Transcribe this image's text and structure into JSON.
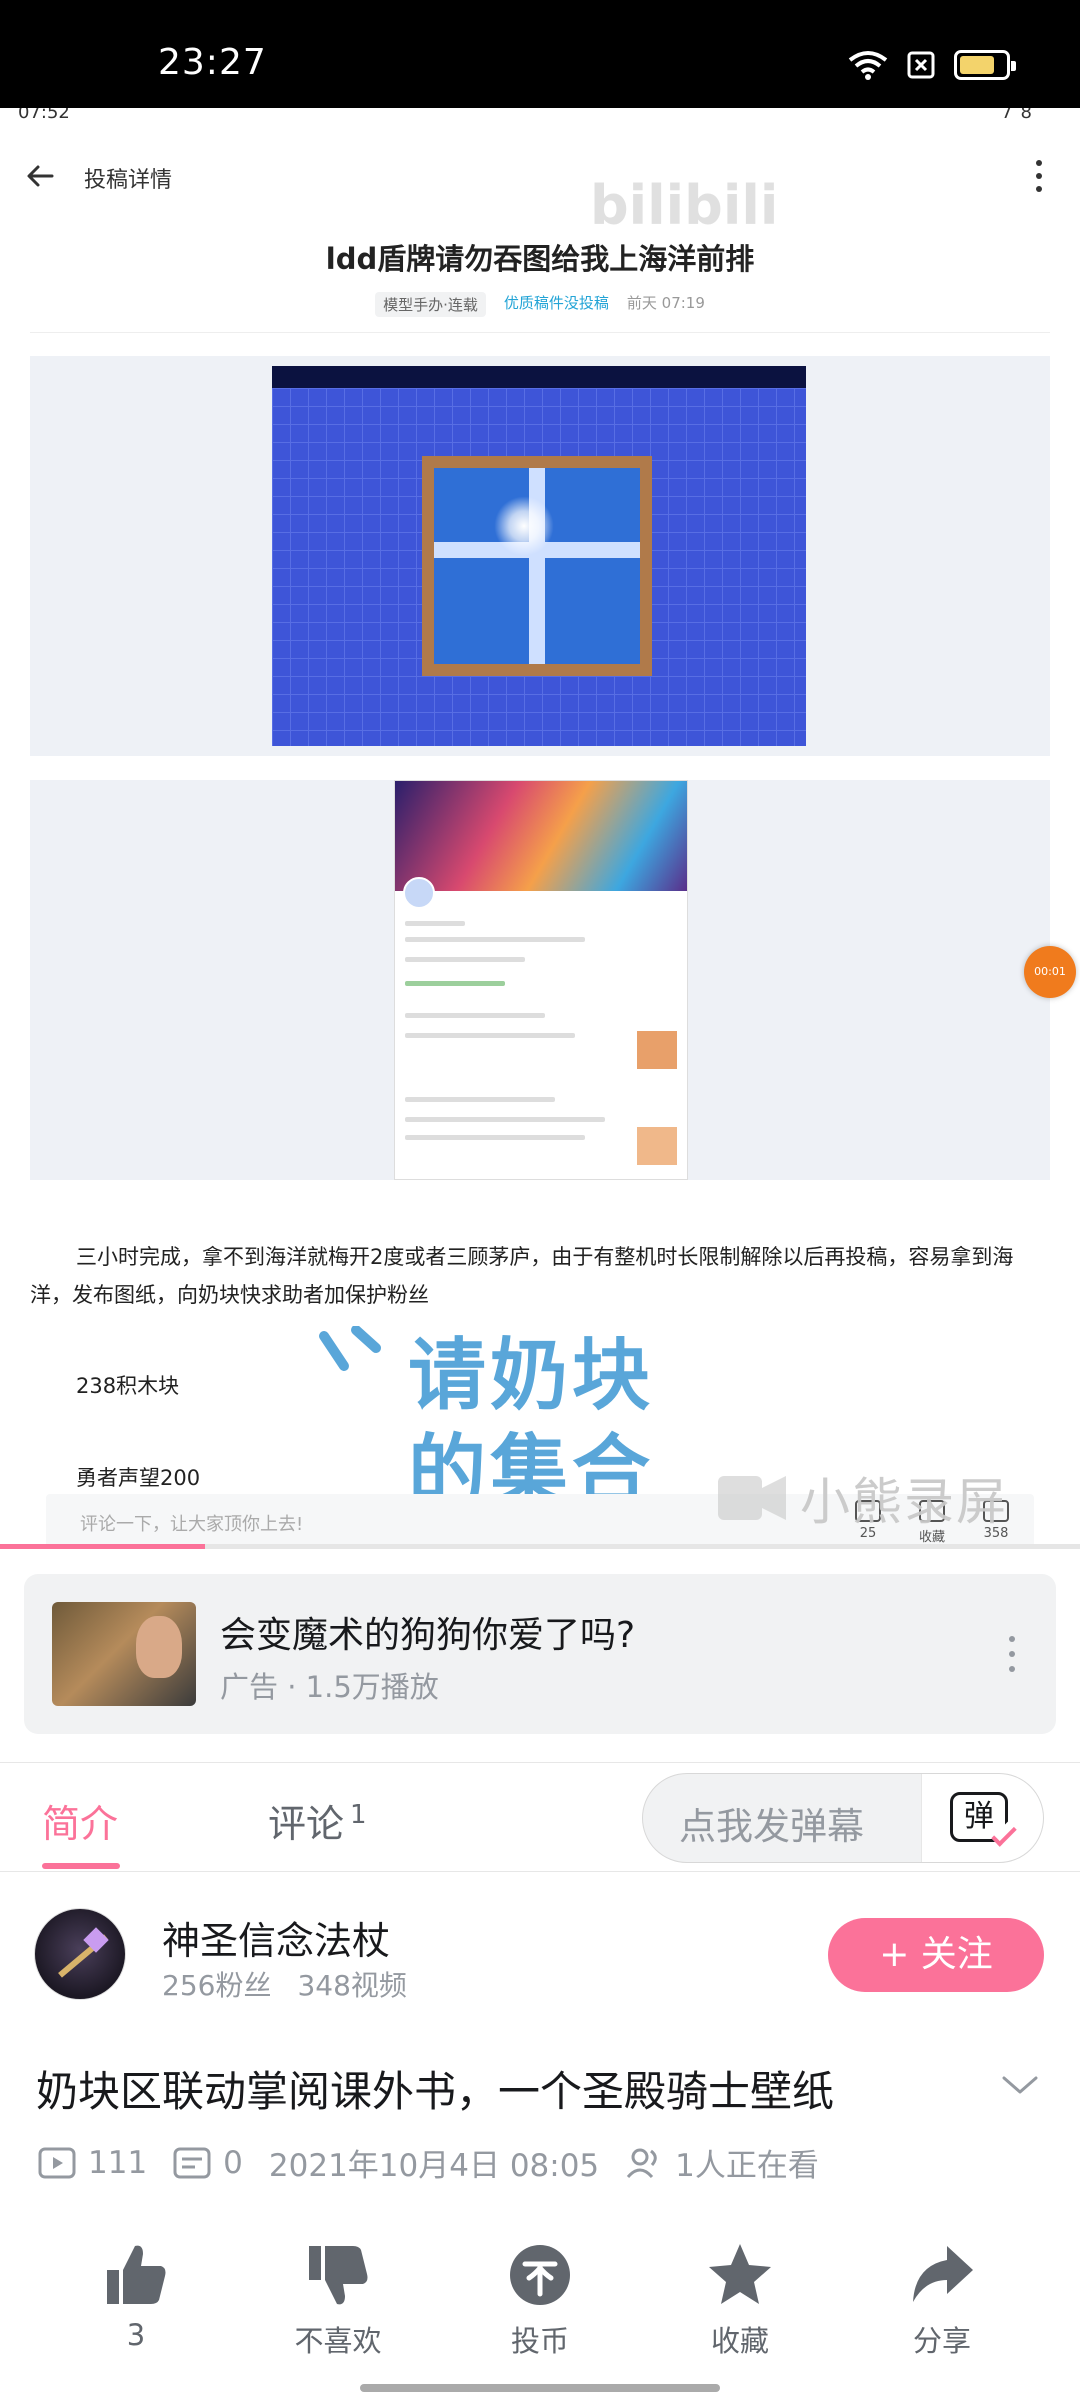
{
  "status_bar": {
    "time": "23:27"
  },
  "player": {
    "inner_time": "07:52",
    "inner_status_right": "78",
    "page_header": "投稿详情",
    "article_title": "ldd盾牌请勿吞图给我上海洋前排",
    "meta_tag": "模型手办·连载",
    "meta_link": "优质稿件没投稿",
    "meta_time": "前天 07:19",
    "article_paragraph": "三小时完成，拿不到海洋就梅开2度或者三顾茅庐，由于有整机时长限制解除以后再投稿，容易拿到海洋，发布图纸，向奶块快求助者加保护粉丝",
    "article_line_1": "238积木块",
    "article_line_2": "勇者声望200",
    "comment_placeholder": "评论一下，让大家顶你上去!",
    "comment_count": "25",
    "collect_label": "收藏",
    "like_count": "358",
    "float_timer": "00:01",
    "watermark_brand": "bilibili",
    "watermark_text_1": "请奶块",
    "watermark_text_2": "的集合",
    "watermark_recorder": "小熊录屏",
    "progress_fraction": 0.19
  },
  "ad": {
    "title": "会变魔术的狗狗你爱了吗?",
    "subtitle": "广告 · 1.5万播放"
  },
  "tabs": {
    "intro": "简介",
    "comments": "评论",
    "comments_count": "1",
    "danmaku_placeholder": "点我发弹幕",
    "danmaku_button": "弹"
  },
  "uploader": {
    "name": "神圣信念法杖",
    "fans": "256粉丝",
    "videos": "348视频",
    "follow_label": "+ 关注"
  },
  "video": {
    "title": "奶块区联动掌阅课外书，一个圣殿骑士壁纸",
    "views": "111",
    "danmaku_count": "0",
    "date": "2021年10月4日 08:05",
    "watching": "1人正在看"
  },
  "actions": {
    "like": "3",
    "dislike": "不喜欢",
    "coin": "投币",
    "favorite": "收藏",
    "share": "分享"
  },
  "colors": {
    "accent": "#fb7299",
    "muted": "#9499a0",
    "text": "#18191c"
  }
}
